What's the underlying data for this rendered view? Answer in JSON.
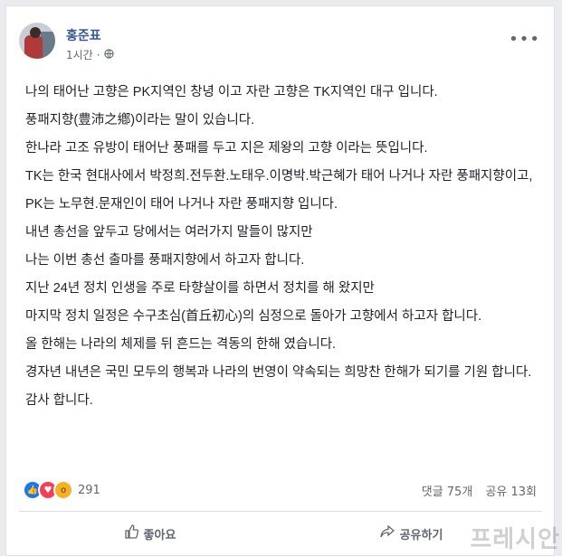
{
  "post": {
    "author": "홍준표",
    "time": "1시간",
    "more_icon": "more-dots-icon",
    "privacy_icon": "globe-icon",
    "paragraphs": [
      "나의 태어난 고향은 PK지역인 창녕 이고 자란 고향은 TK지역인 대구 입니다.",
      "풍패지향(豊沛之鄕)이라는 말이 있습니다.",
      "한나라 고조 유방이 태어난 풍패를 두고 지은 제왕의 고향 이라는 뜻입니다.",
      "TK는 한국 현대사에서 박정희.전두환.노태우.이명박.박근혜가 태어 나거나 자란 풍패지향이고,",
      "PK는 노무현.문재인이 태어 나거나 자란 풍패지향 입니다.",
      "내년 총선을 앞두고 당에서는 여러가지 말들이 많지만",
      "나는 이번 총선 출마를 풍패지향에서 하고자 합니다.",
      "지난 24년 정치 인생을 주로 타향살이를 하면서 정치를 해 왔지만",
      "마지막 정치 일정은 수구초심(首丘初心)의 심정으로 돌아가 고향에서 하고자 합니다.",
      "올 한해는 나라의 체제를 뒤 흔드는 격동의 한해 였습니다.",
      "경자년 내년은 국민 모두의 행복과 나라의 번영이 약속되는 희망찬 한해가 되기를 기원 합니다.",
      "감사 합니다."
    ]
  },
  "stats": {
    "reaction_count": "291",
    "comments": "댓글 75개",
    "shares": "공유 13회"
  },
  "actions": {
    "like_label": "좋아요",
    "share_label": "공유하기"
  },
  "watermark": "프레시안",
  "colors": {
    "author": "#365899",
    "like": "#1877f2",
    "love": "#f33e58",
    "wow": "#f7b125"
  }
}
